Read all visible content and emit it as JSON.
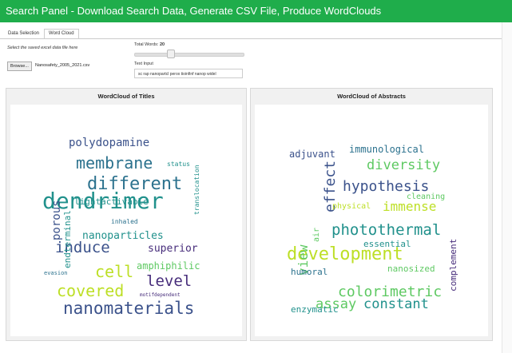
{
  "header": {
    "title": "Search Panel - Download Search Data, Generate CSV File, Produce WordClouds"
  },
  "tabs": [
    {
      "label": "Data Selection"
    },
    {
      "label": "Word Cloud"
    }
  ],
  "file_input": {
    "label": "Select the saved excel data file here",
    "browse_label": "Browse...",
    "file_name": "Nanosafety_2005_2021.csv"
  },
  "total_words": {
    "label": "Total Words:",
    "value": "20",
    "fraction": 0.2
  },
  "text_input": {
    "label": "Text Input",
    "value": "sc rap nanopartcl perox tioinfinf nanop widel"
  },
  "panels": {
    "titles": {
      "title": "WordCloud of Titles"
    },
    "abstracts": {
      "title": "WordCloud of Abstracts"
    }
  },
  "colors": {
    "header_bg": "#1fad4b",
    "panel_bg": "#f1f1f1",
    "wordcloud_palette": [
      "#440154",
      "#3b528b",
      "#21918c",
      "#5ec962",
      "#bddf26",
      "#2c728e",
      "#472d7b"
    ]
  },
  "wordcloud_titles": {
    "words": [
      {
        "text": "dendrimer",
        "size": 28,
        "color": "#21918c",
        "rotate": false
      },
      {
        "text": "nanomaterials",
        "size": 21,
        "color": "#3b528b",
        "rotate": false
      },
      {
        "text": "different",
        "size": 22,
        "color": "#2c728e",
        "rotate": false
      },
      {
        "text": "membrane",
        "size": 20,
        "color": "#2c728e",
        "rotate": false
      },
      {
        "text": "induce",
        "size": 19,
        "color": "#3b528b",
        "rotate": false
      },
      {
        "text": "covered",
        "size": 20,
        "color": "#bddf26",
        "rotate": false
      },
      {
        "text": "cell",
        "size": 20,
        "color": "#bddf26",
        "rotate": false
      },
      {
        "text": "level",
        "size": 19,
        "color": "#472d7b",
        "rotate": false
      },
      {
        "text": "polydopamine",
        "size": 14,
        "color": "#3b528b",
        "rotate": false
      },
      {
        "text": "nanoparticles",
        "size": 13,
        "color": "#21918c",
        "rotate": false
      },
      {
        "text": "superior",
        "size": 13,
        "color": "#472d7b",
        "rotate": false
      },
      {
        "text": "amphiphilic",
        "size": 12,
        "color": "#5ec962",
        "rotate": false
      },
      {
        "text": "lightactivable",
        "size": 11,
        "color": "#21918c",
        "rotate": false
      },
      {
        "text": "porous",
        "size": 14,
        "color": "#3b528b",
        "rotate": true
      },
      {
        "text": "endterminal",
        "size": 11,
        "color": "#21918c",
        "rotate": true
      },
      {
        "text": "translocation",
        "size": 8,
        "color": "#21918c",
        "rotate": true
      },
      {
        "text": "inhaled",
        "size": 8,
        "color": "#2c728e",
        "rotate": false
      },
      {
        "text": "status",
        "size": 8,
        "color": "#21918c",
        "rotate": false
      },
      {
        "text": "evasion",
        "size": 7,
        "color": "#2c728e",
        "rotate": false
      },
      {
        "text": "motifdependent",
        "size": 6,
        "color": "#472d7b",
        "rotate": false
      }
    ]
  },
  "wordcloud_abstracts": {
    "words": [
      {
        "text": "development",
        "size": 22,
        "color": "#bddf26",
        "rotate": false
      },
      {
        "text": "photothermal",
        "size": 19,
        "color": "#21918c",
        "rotate": false
      },
      {
        "text": "hypothesis",
        "size": 18,
        "color": "#3b528b",
        "rotate": false
      },
      {
        "text": "diversity",
        "size": 17,
        "color": "#5ec962",
        "rotate": false
      },
      {
        "text": "colorimetric",
        "size": 18,
        "color": "#5ec962",
        "rotate": false
      },
      {
        "text": "constant",
        "size": 17,
        "color": "#21918c",
        "rotate": false
      },
      {
        "text": "assay",
        "size": 17,
        "color": "#5ec962",
        "rotate": false
      },
      {
        "text": "immense",
        "size": 16,
        "color": "#bddf26",
        "rotate": false
      },
      {
        "text": "effect",
        "size": 18,
        "color": "#3b528b",
        "rotate": true
      },
      {
        "text": "view",
        "size": 16,
        "color": "#5ec962",
        "rotate": true
      },
      {
        "text": "immunological",
        "size": 12,
        "color": "#2c728e",
        "rotate": false
      },
      {
        "text": "adjuvant",
        "size": 12,
        "color": "#3b528b",
        "rotate": false
      },
      {
        "text": "essential",
        "size": 11,
        "color": "#21918c",
        "rotate": false
      },
      {
        "text": "physical",
        "size": 10,
        "color": "#bddf26",
        "rotate": false
      },
      {
        "text": "cleaning",
        "size": 10,
        "color": "#5ec962",
        "rotate": false
      },
      {
        "text": "humoral",
        "size": 11,
        "color": "#2c728e",
        "rotate": false
      },
      {
        "text": "nanosized",
        "size": 11,
        "color": "#5ec962",
        "rotate": false
      },
      {
        "text": "enzymatic",
        "size": 11,
        "color": "#21918c",
        "rotate": false
      },
      {
        "text": "complement",
        "size": 11,
        "color": "#472d7b",
        "rotate": true
      },
      {
        "text": "air",
        "size": 10,
        "color": "#5ec962",
        "rotate": true
      }
    ]
  }
}
